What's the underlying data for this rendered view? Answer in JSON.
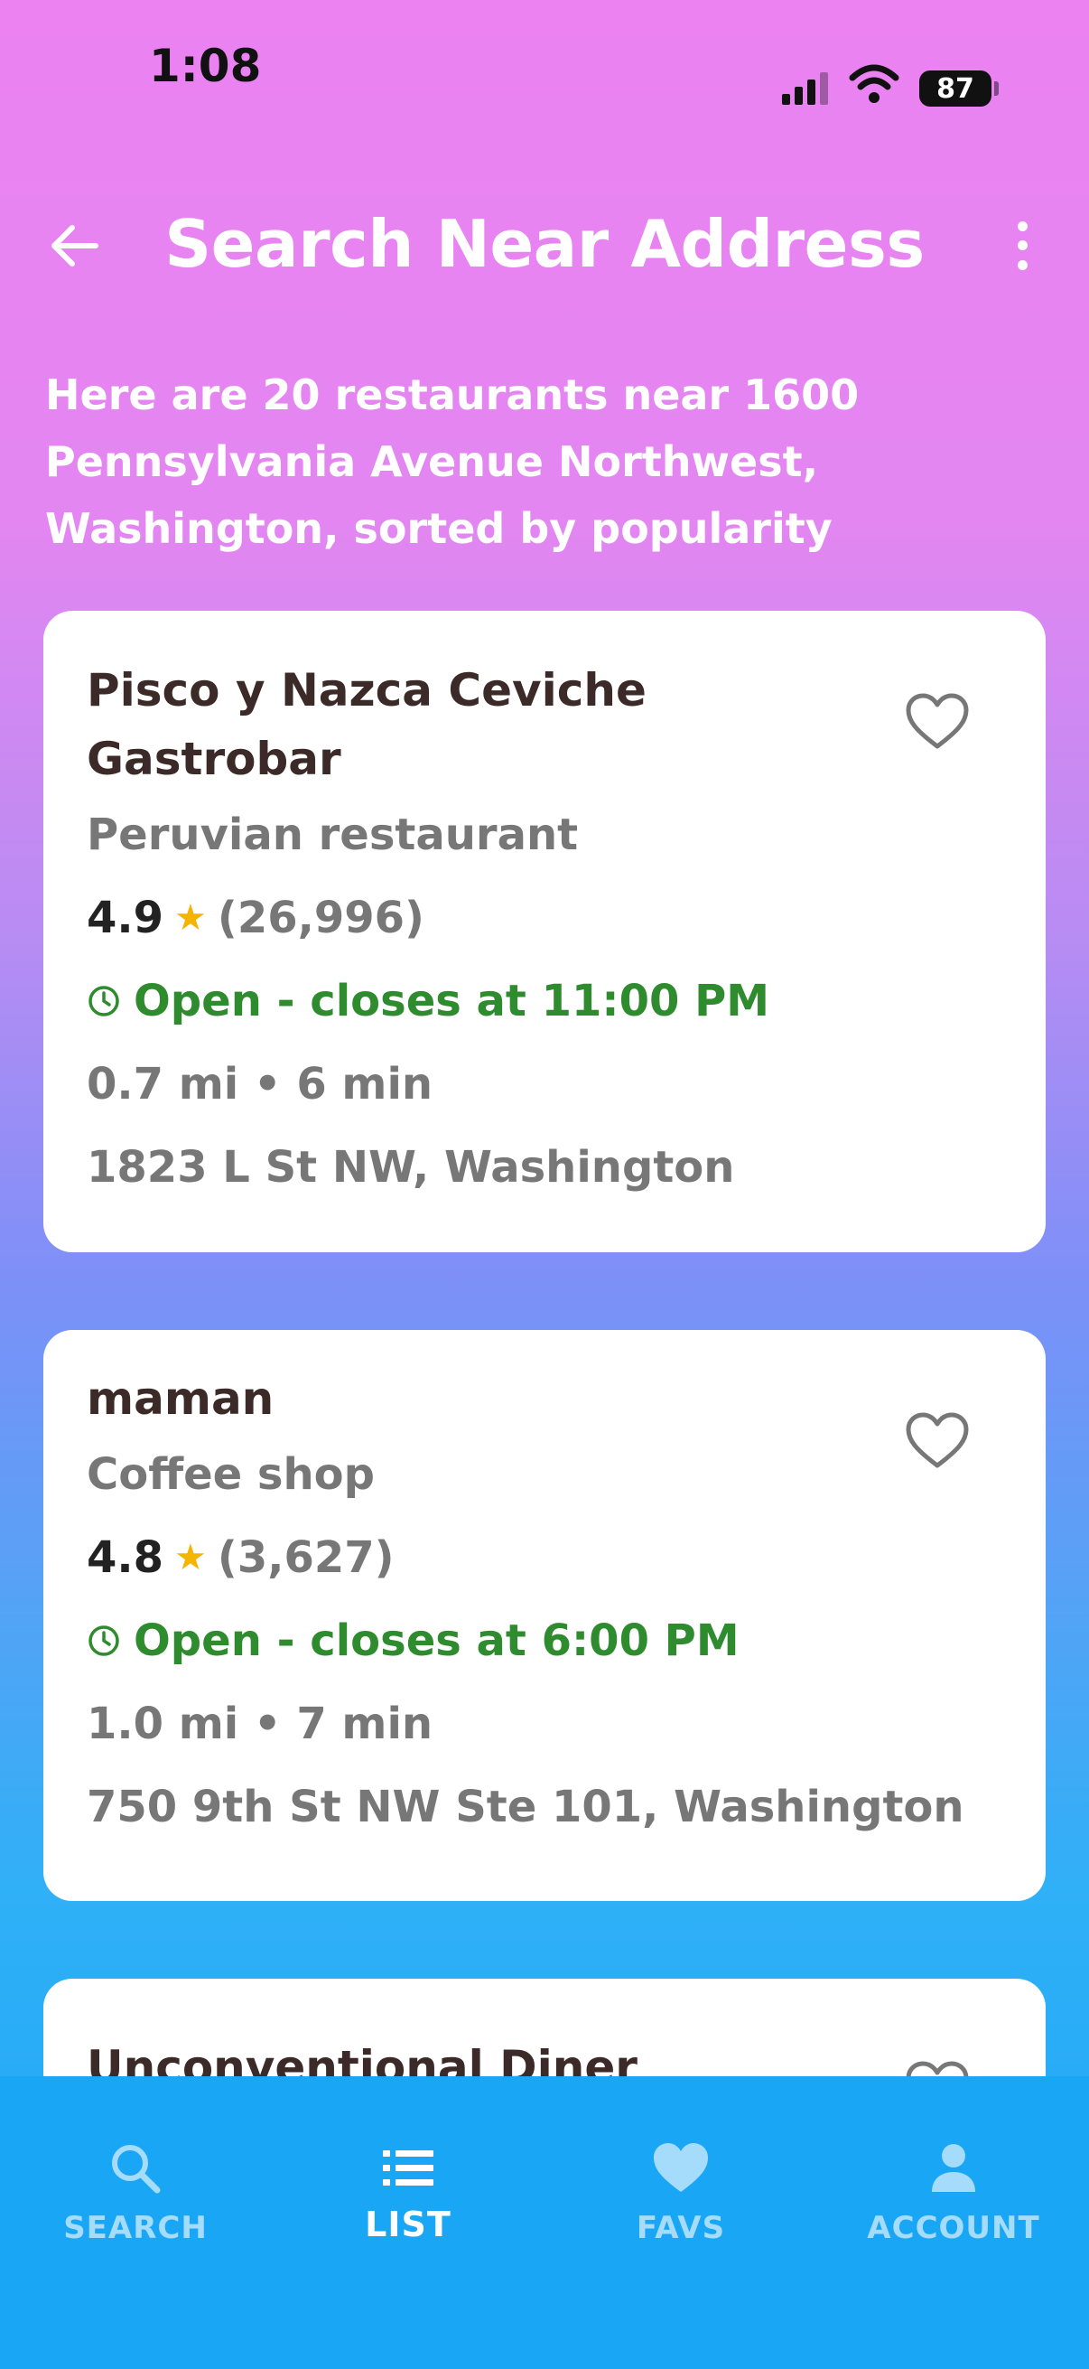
{
  "status_bar": {
    "time": "1:08",
    "battery": "87"
  },
  "header": {
    "title": "Search Near Address"
  },
  "summary": "Here are 20 restaurants near 1600 Pennsylvania Avenue Northwest, Washington, sorted by popularity",
  "restaurants": [
    {
      "name": "Pisco y Nazca Ceviche Gastrobar",
      "category": "Peruvian restaurant",
      "rating": "4.9",
      "reviews": "(26,996)",
      "hours": "Open - closes at 11:00 PM",
      "distance": "0.7 mi • 6 min",
      "address": "1823 L St NW, Washington"
    },
    {
      "name": "maman",
      "category": "Coffee shop",
      "rating": "4.8",
      "reviews": "(3,627)",
      "hours": "Open - closes at 6:00 PM",
      "distance": "1.0 mi • 7 min",
      "address": "750 9th St NW Ste 101, Washington"
    },
    {
      "name": "Unconventional Diner"
    }
  ],
  "nav": {
    "search": "SEARCH",
    "list": "LIST",
    "favs": "FAVS",
    "account": "ACCOUNT"
  },
  "colors": {
    "open_green": "#2e8b2e",
    "star": "#f5b400",
    "nav_bg": "#19a6f5"
  }
}
